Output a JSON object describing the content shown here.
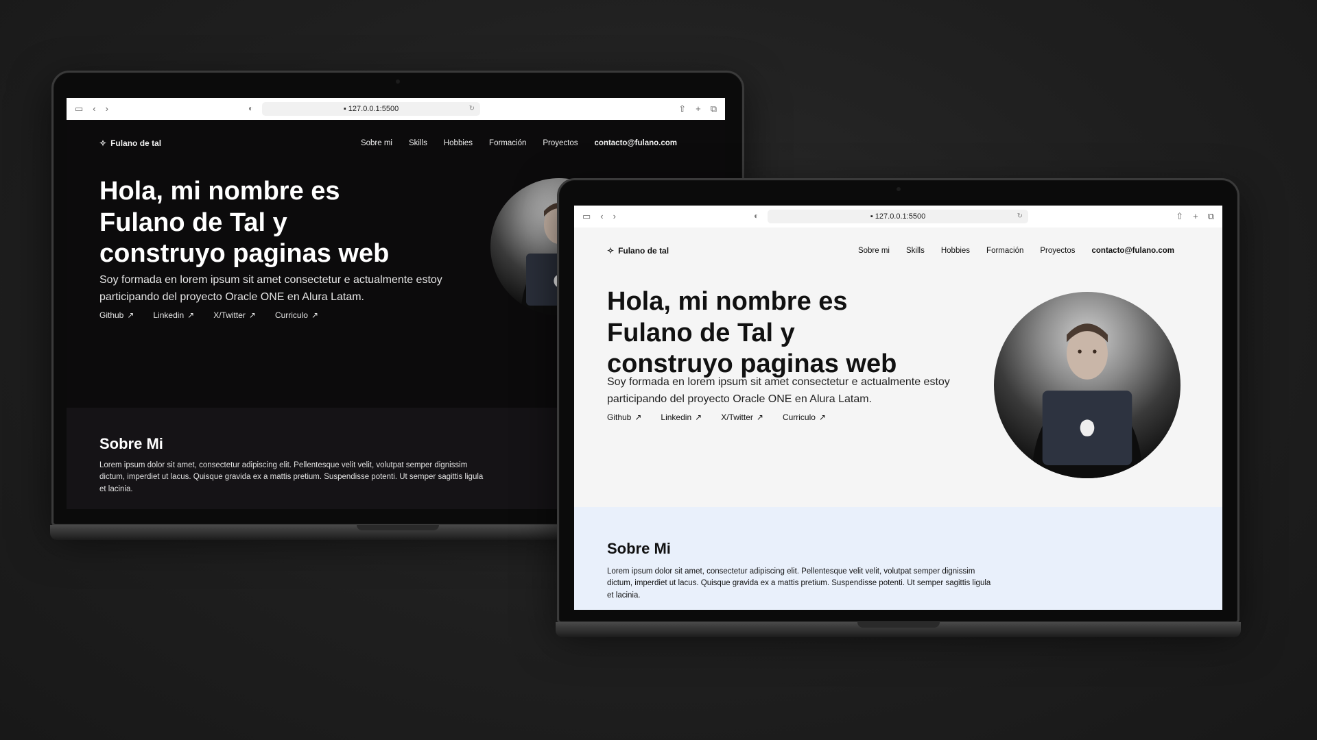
{
  "browser": {
    "url": "127.0.0.1:5500",
    "url_prefix": "▪ "
  },
  "site": {
    "brand": "Fulano de tal",
    "nav": {
      "sobre_mi": "Sobre mi",
      "skills": "Skills",
      "hobbies": "Hobbies",
      "formacion": "Formación",
      "proyectos": "Proyectos",
      "contact": "contacto@fulano.com"
    },
    "hero": {
      "title": "Hola, mi nombre es Fulano de Tal y construyo paginas web",
      "description": "Soy formada en lorem ipsum sit amet consectetur e actualmente estoy participando del proyecto Oracle ONE en Alura Latam.",
      "links": {
        "github": "Github",
        "linkedin": "Linkedin",
        "twitter": "X/Twitter",
        "curriculo": "Curriculo"
      },
      "link_arrow": "↗"
    },
    "about": {
      "heading": "Sobre Mi",
      "text": "Lorem ipsum dolor sit amet, consectetur adipiscing elit. Pellentesque velit velit, volutpat semper dignissim dictum, imperdiet ut lacus. Quisque gravida ex a mattis pretium. Suspendisse potenti. Ut semper sagittis ligula et lacinia."
    }
  },
  "themes": {
    "dark": {
      "background": "#0c0b0c",
      "text": "#ffffff",
      "section": "#151316"
    },
    "light": {
      "background": "#f5f5f5",
      "text": "#111111",
      "section": "#e9f0fb"
    }
  },
  "icons": {
    "brand": "sparkles-icon",
    "sidebar": "sidebar-icon",
    "back": "chevron-left-icon",
    "forward": "chevron-right-icon",
    "privacy": "shield-icon",
    "reload": "reload-icon",
    "share": "share-icon",
    "new_tab": "plus-icon",
    "tabs": "tabs-icon",
    "external": "arrow-up-right-icon"
  }
}
